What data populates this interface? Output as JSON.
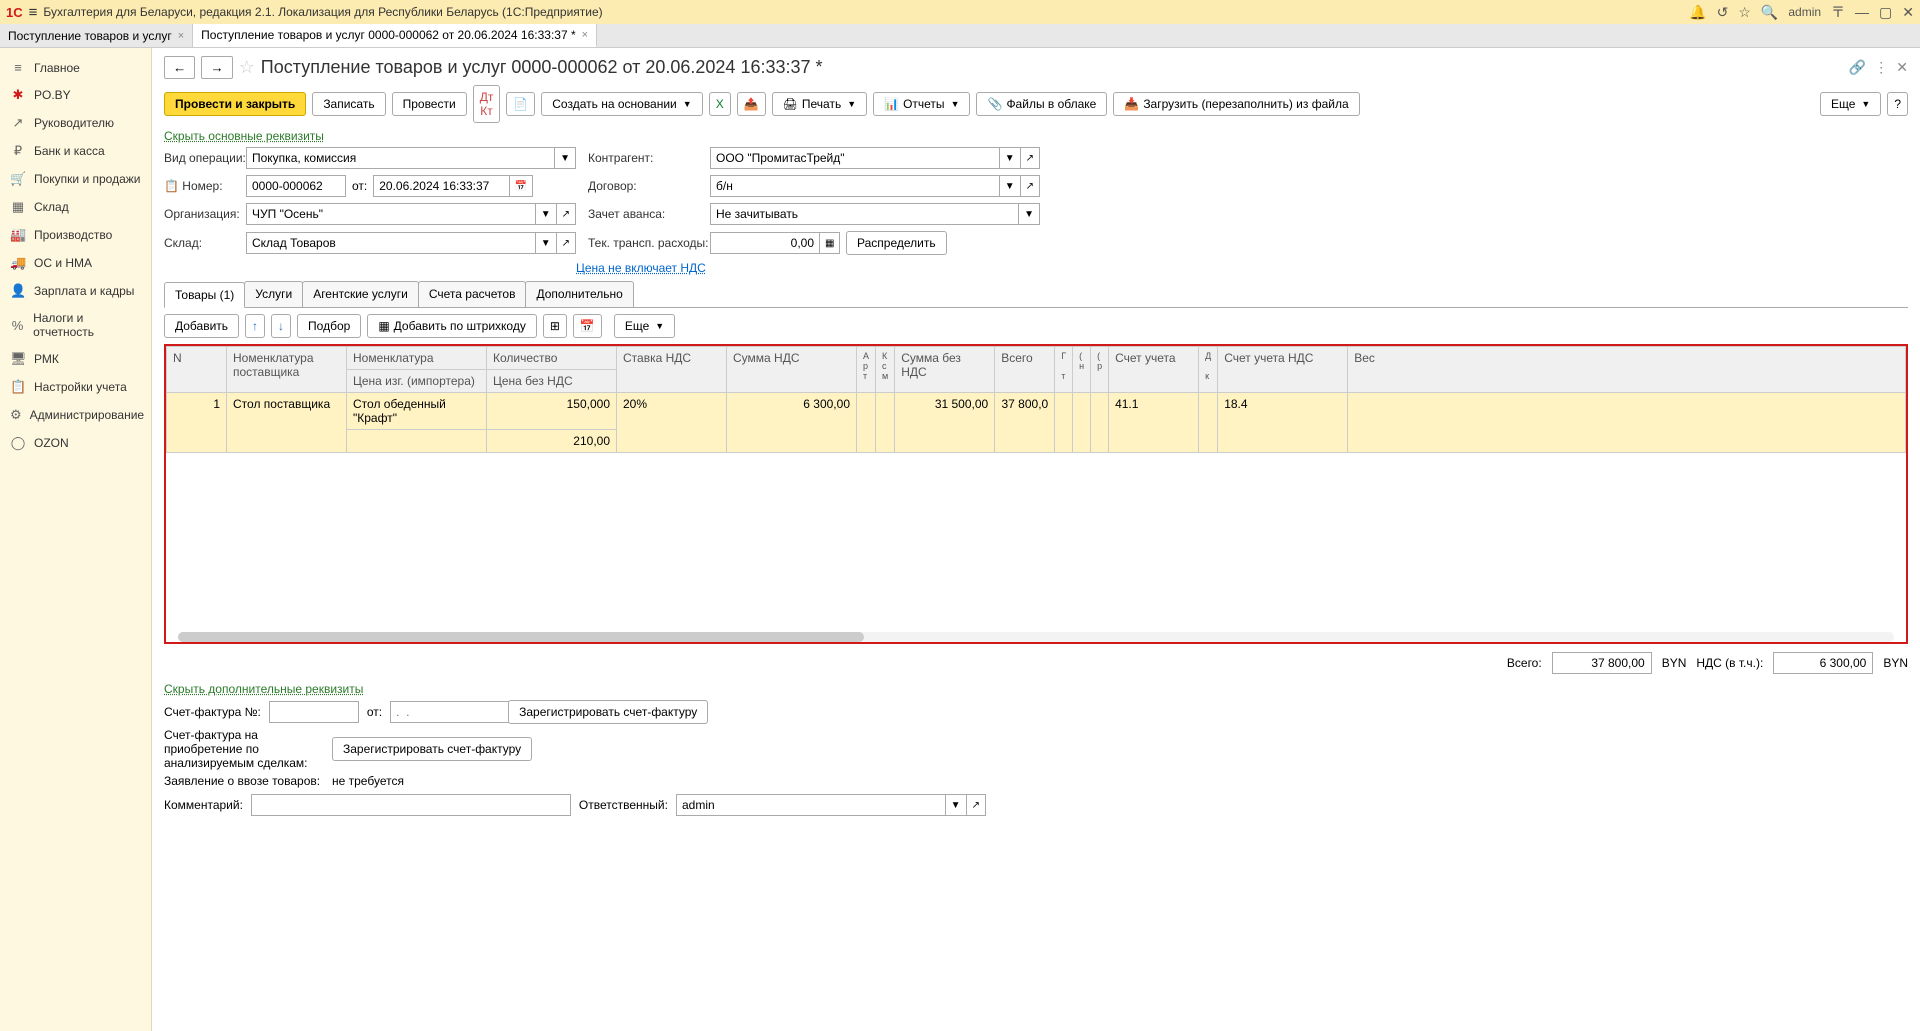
{
  "titlebar": {
    "text": "Бухгалтерия для Беларуси, редакция 2.1. Локализация для Республики Беларусь   (1С:Предприятие)",
    "user": "admin"
  },
  "tabs": [
    {
      "label": "Поступление товаров и услуг",
      "active": false
    },
    {
      "label": "Поступление товаров и услуг 0000-000062 от 20.06.2024 16:33:37 *",
      "active": true
    }
  ],
  "sidebar": [
    {
      "label": "Главное",
      "icon": "≡"
    },
    {
      "label": "PO.BY",
      "icon": "✱",
      "cls": "poby"
    },
    {
      "label": "Руководителю",
      "icon": "↗"
    },
    {
      "label": "Банк и касса",
      "icon": "₽"
    },
    {
      "label": "Покупки и продажи",
      "icon": "🛒"
    },
    {
      "label": "Склад",
      "icon": "▦"
    },
    {
      "label": "Производство",
      "icon": "🏭"
    },
    {
      "label": "ОС и НМА",
      "icon": "🚚"
    },
    {
      "label": "Зарплата и кадры",
      "icon": "👤"
    },
    {
      "label": "Налоги и отчетность",
      "icon": "%"
    },
    {
      "label": "РМК",
      "icon": "🖥"
    },
    {
      "label": "Настройки учета",
      "icon": "📋"
    },
    {
      "label": "Администрирование",
      "icon": "⚙"
    },
    {
      "label": "OZON",
      "icon": "◯"
    }
  ],
  "pageTitle": "Поступление товаров и услуг 0000-000062 от 20.06.2024 16:33:37 *",
  "toolbar": {
    "postAndClose": "Провести и закрыть",
    "save": "Записать",
    "post": "Провести",
    "createBased": "Создать на основании",
    "print": "Печать",
    "reports": "Отчеты",
    "filesCloud": "Файлы в облаке",
    "loadFromFile": "Загрузить (перезаполнить) из файла",
    "more": "Еще"
  },
  "links": {
    "hideMain": "Скрыть основные реквизиты",
    "priceNoVat": "Цена не включает НДС",
    "hideExtra": "Скрыть дополнительные реквизиты"
  },
  "form": {
    "operationTypeLabel": "Вид операции:",
    "operationType": "Покупка, комиссия",
    "numberLabel": "Номер:",
    "number": "0000-000062",
    "fromLabel": "от:",
    "date": "20.06.2024 16:33:37",
    "orgLabel": "Организация:",
    "org": "ЧУП \"Осень\"",
    "warehouseLabel": "Склад:",
    "warehouse": "Склад Товаров",
    "contractorLabel": "Контрагент:",
    "contractor": "ООО \"ПромитасТрейд\"",
    "contractLabel": "Договор:",
    "contract": "б/н",
    "advanceLabel": "Зачет аванса:",
    "advance": "Не зачитывать",
    "transportLabel": "Тек. трансп. расходы:",
    "transportValue": "0,00",
    "distribute": "Распределить"
  },
  "docTabs": [
    {
      "label": "Товары (1)",
      "active": true
    },
    {
      "label": "Услуги",
      "active": false
    },
    {
      "label": "Агентские услуги",
      "active": false
    },
    {
      "label": "Счета расчетов",
      "active": false
    },
    {
      "label": "Дополнительно",
      "active": false
    }
  ],
  "tableToolbar": {
    "add": "Добавить",
    "pick": "Подбор",
    "addByBarcode": "Добавить по штрихкоду"
  },
  "columns": {
    "n": "N",
    "supplierNom": "Номенклатура поставщика",
    "nom": "Номенклатура",
    "mfgPrice": "Цена изг. (импортера)",
    "qty": "Количество",
    "priceNoVat": "Цена без НДС",
    "vatRate": "Ставка НДС",
    "vatSum": "Сумма НДС",
    "sumNoVat": "Сумма без НДС",
    "total": "Всего",
    "account": "Счет учета",
    "vatAccount": "Счет учета НДС",
    "weight": "Вес"
  },
  "rows": [
    {
      "n": "1",
      "supplierNom": "Стол поставщика",
      "nom": "Стол обеденный \"Крафт\"",
      "qty": "150,000",
      "priceNoVat": "210,00",
      "vatRate": "20%",
      "vatSum": "6 300,00",
      "sumNoVat": "31 500,00",
      "total": "37 800,0",
      "account": "41.1",
      "vatAccount": "18.4"
    }
  ],
  "totals": {
    "allLabel": "Всего:",
    "allValue": "37 800,00",
    "currency": "BYN",
    "vatLabel": "НДС (в т.ч.):",
    "vatValue": "6 300,00"
  },
  "invoice": {
    "numberLabel": "Счет-фактура №:",
    "fromLabel": "от:",
    "datePlaceholder": ".  .",
    "registerBtn": "Зарегистрировать счет-фактуру",
    "analysisLabel": "Счет-фактура на приобретение по анализируемым сделкам:",
    "registerBtn2": "Зарегистрировать счет-фактуру",
    "importLabel": "Заявление о ввозе товаров:",
    "importValue": "не требуется"
  },
  "footer": {
    "commentLabel": "Комментарий:",
    "responsibleLabel": "Ответственный:",
    "responsible": "admin"
  }
}
